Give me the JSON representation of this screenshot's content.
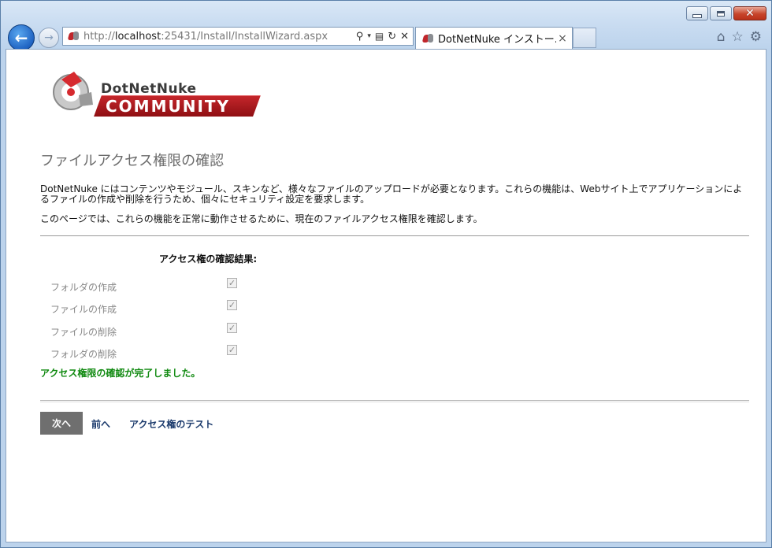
{
  "browser": {
    "address": {
      "scheme": "http://",
      "host": "localhost",
      "path": ":25431/Install/InstallWizard.aspx"
    },
    "tab_title": "DotNetNuke インストー...",
    "tab_close": "×"
  },
  "logo": {
    "line1": "DotNetNuke",
    "line2": "COMMUNITY"
  },
  "page": {
    "title": "ファイルアクセス権限の確認",
    "description": "DotNetNuke にはコンテンツやモジュール、スキンなど、様々なファイルのアップロードが必要となります。これらの機能は、Webサイト上でアプリケーションによるファイルの作成や削除を行うため、個々にセキュリティ設定を要求します。",
    "explanation": "このページでは、これらの機能を正常に動作させるために、現在のファイルアクセス権限を確認します。",
    "results_title": "アクセス権の確認結果:",
    "permissions": [
      {
        "label": "フォルダの作成",
        "checked": true
      },
      {
        "label": "ファイルの作成",
        "checked": true
      },
      {
        "label": "ファイルの削除",
        "checked": true
      },
      {
        "label": "フォルダの削除",
        "checked": true
      }
    ],
    "status_message": "アクセス権限の確認が完了しました。",
    "status_color": "#118a11",
    "buttons": {
      "next": "次へ",
      "previous": "前へ",
      "test": "アクセス権のテスト"
    }
  },
  "colors": {
    "brand_red": "#c4262b",
    "link": "#1b3a6c",
    "next_button_bg": "#6f6f6f"
  },
  "icons": [
    "back-icon",
    "forward-icon",
    "search-icon",
    "dropdown-icon",
    "compatibility-icon",
    "refresh-icon",
    "stop-icon",
    "home-icon",
    "favorites-star-icon",
    "tools-gear-icon"
  ]
}
